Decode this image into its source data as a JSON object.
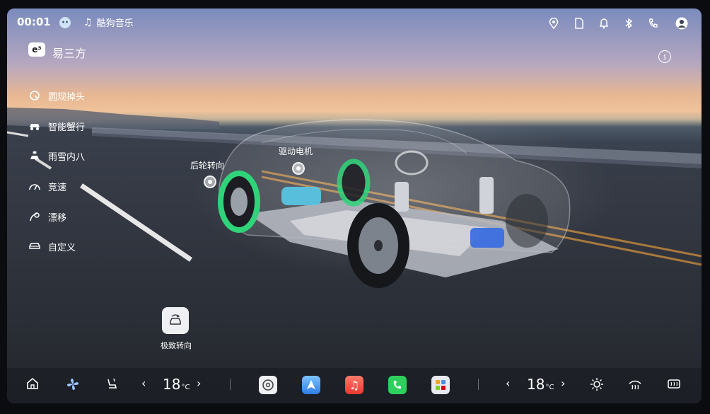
{
  "status_bar": {
    "time": "00:01",
    "media_app": "酷狗音乐"
  },
  "app": {
    "badge": "e³",
    "title": "易三方",
    "info_symbol": "i"
  },
  "menu": {
    "items": [
      {
        "label": "圆规掉头",
        "icon": "u-turn-icon"
      },
      {
        "label": "智能蟹行",
        "icon": "crab-walk-icon"
      },
      {
        "label": "雨雪内八",
        "icon": "snow-icon"
      },
      {
        "label": "竞速",
        "icon": "speedometer-icon"
      },
      {
        "label": "漂移",
        "icon": "drift-icon"
      },
      {
        "label": "自定义",
        "icon": "car-custom-icon"
      }
    ]
  },
  "hotspots": {
    "rear_steering": "后轮转向",
    "drive_motor": "驱动电机"
  },
  "extreme_turn": {
    "label": "极致转向"
  },
  "dock": {
    "left_temp": "18",
    "right_temp": "18",
    "temp_unit": "°C"
  },
  "colors": {
    "accent_green": "#2fd47a",
    "motor_blue": "#3b6fe0",
    "dock_bg": "#1c1f26"
  }
}
